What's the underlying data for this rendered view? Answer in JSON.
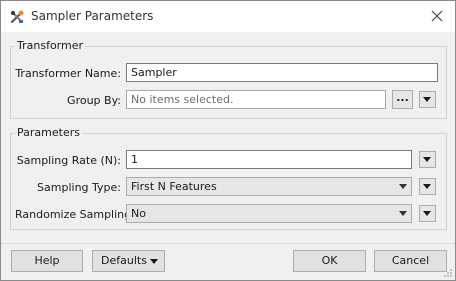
{
  "window": {
    "title": "Sampler Parameters",
    "app_icon": "fme-workbench-icon",
    "close_icon": "close-icon"
  },
  "transformer_group": {
    "title": "Transformer",
    "name_label": "Transformer Name:",
    "name_value": "Sampler",
    "group_by_label": "Group By:",
    "group_by_placeholder": "No items selected.",
    "ellipsis_label": "..."
  },
  "parameters_group": {
    "title": "Parameters",
    "sampling_rate_label": "Sampling Rate (N):",
    "sampling_rate_value": "1",
    "sampling_type_label": "Sampling Type:",
    "sampling_type_value": "First N Features",
    "randomize_label": "Randomize Sampling:",
    "randomize_value": "No"
  },
  "buttons": {
    "help": "Help",
    "defaults": "Defaults",
    "ok": "OK",
    "cancel": "Cancel"
  }
}
